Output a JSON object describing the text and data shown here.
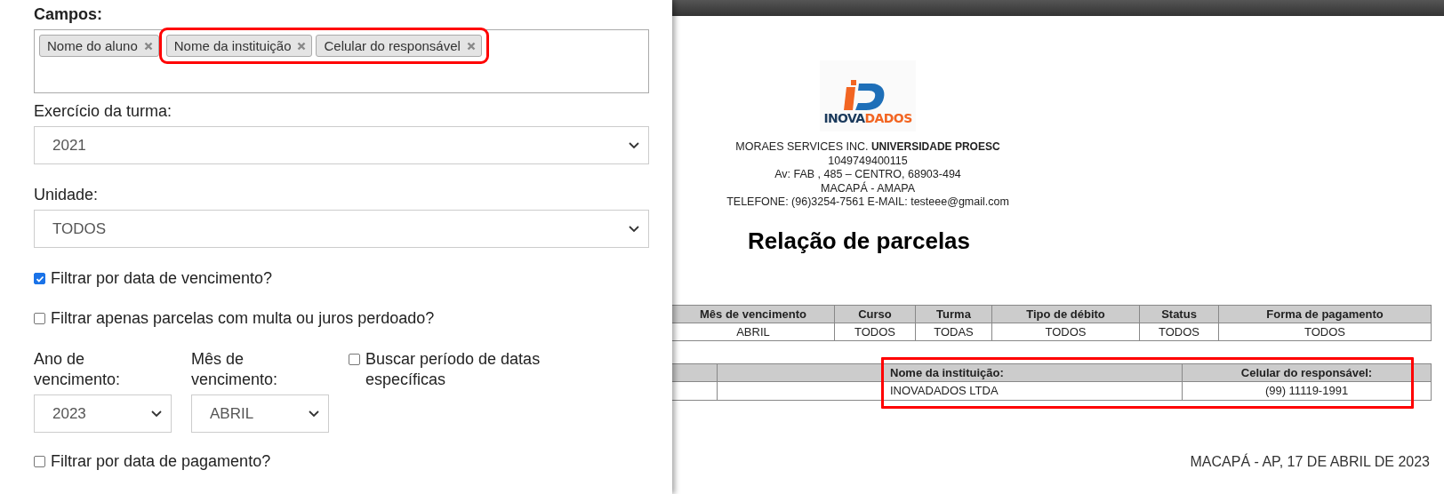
{
  "form": {
    "fields_label": "Campos:",
    "tags": [
      {
        "label": "Nome do aluno",
        "highlighted": false
      },
      {
        "label": "Nome da instituição",
        "highlighted": true
      },
      {
        "label": "Celular do responsável",
        "highlighted": true
      }
    ],
    "year_label": "Exercício da turma:",
    "year_value": "2021",
    "unit_label": "Unidade:",
    "unit_value": "TODOS",
    "filter_due": {
      "label": "Filtrar por data de vencimento?",
      "checked": true
    },
    "filter_forgiven": {
      "label": "Filtrar apenas parcelas com multa ou juros perdoado?",
      "checked": false
    },
    "due_year_label": "Ano de vencimento:",
    "due_year_value": "2023",
    "due_month_label": "Mês de vencimento:",
    "due_month_value": "ABRIL",
    "period": {
      "label": "Buscar período de datas específicas",
      "checked": false
    },
    "filter_payment": {
      "label": "Filtrar por data de pagamento?",
      "checked": false
    }
  },
  "report": {
    "logo": [
      "INOVA",
      "DADOS"
    ],
    "company_lines": [
      "MORAES SERVICES INC. **UNIVERSIDADE PROESC**",
      "1049749400115",
      "Av: FAB , 485 – CENTRO, 68903-494",
      "MACAPÁ - AMAPA",
      "TELEFONE: (96)3254-7561 E-MAIL: testeee@gmail.com"
    ],
    "title": "Relação de parcelas",
    "filters_table": {
      "columns": [
        "Mês de vencimento",
        "Curso",
        "Turma",
        "Tipo de débito",
        "Status",
        "Forma de pagamento"
      ],
      "row": [
        "ABRIL",
        "TODOS",
        "TODAS",
        "TODOS",
        "TODOS",
        "TODOS"
      ]
    },
    "data_table": {
      "columns": [
        {
          "highlighted": false
        },
        {
          "highlighted": false
        },
        {
          "label": "Nome da instituição:",
          "cell": "INOVADADOS LTDA",
          "highlighted": true
        },
        {
          "label": "Celular do responsável:",
          "cell": "(99) 11119-1991",
          "highlighted": true
        }
      ]
    },
    "footer_date": "MACAPÁ - AP, 17 DE ABRIL DE 2023"
  }
}
